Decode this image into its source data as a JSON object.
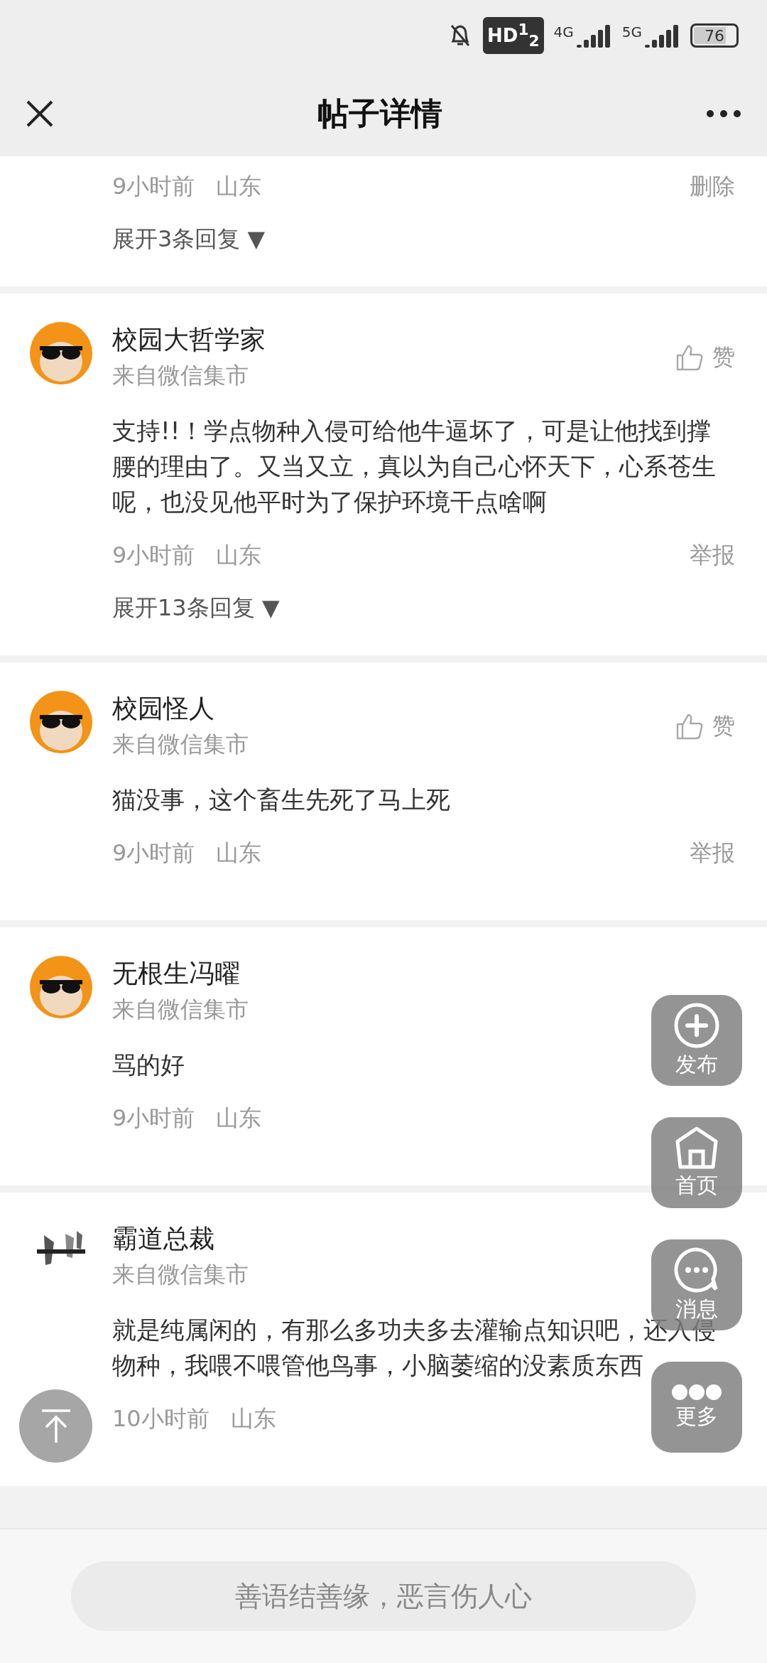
{
  "status_bar": {
    "hd": "HD$^{1}$$_{2}$",
    "network_1": "4G",
    "network_2": "5G",
    "battery": "76"
  },
  "header": {
    "title": "帖子详情"
  },
  "comments": [
    {
      "time": "9小时前",
      "location": "山东",
      "action": "删除",
      "expand": "展开3条回复 ▼"
    },
    {
      "avatar": {
        "kind": "hamster"
      },
      "name": "校园大哲学家",
      "source": "来自微信集市",
      "like": "赞",
      "text": "支持!!！学点物种入侵可给他牛逼坏了，可是让他找到撑腰的理由了。又当又立，真以为自己心怀天下，心系苍生呢，也没见他平时为了保护环境干点啥啊",
      "time": "9小时前",
      "location": "山东",
      "action": "举报",
      "expand": "展开13条回复 ▼"
    },
    {
      "avatar": {
        "kind": "hamster"
      },
      "name": "校园怪人",
      "source": "来自微信集市",
      "like": "赞",
      "text": "猫没事，这个畜生先死了马上死",
      "time": "9小时前",
      "location": "山东",
      "action": "举报"
    },
    {
      "avatar": {
        "kind": "hamster"
      },
      "name": "无根生冯曜",
      "source": "来自微信集市",
      "text": "骂的好",
      "time": "9小时前",
      "location": "山东"
    },
    {
      "name": "霸道总裁",
      "source": "来自微信集市",
      "text": "就是纯属闲的，有那么多功夫多去灌输点知识吧，还入侵物种，我喂不喂管他鸟事，小脑萎缩的没素质东西",
      "time": "10小时前",
      "location": "山东"
    }
  ],
  "floating_buttons": [
    {
      "kind": "plus",
      "label": "发布"
    },
    {
      "kind": "home",
      "label": "首页"
    },
    {
      "kind": "chat",
      "label": "消息"
    },
    {
      "kind": "more",
      "label": "更多"
    }
  ],
  "bottom_bar": {
    "placeholder": "善语结善缘，恶言伤人心"
  }
}
